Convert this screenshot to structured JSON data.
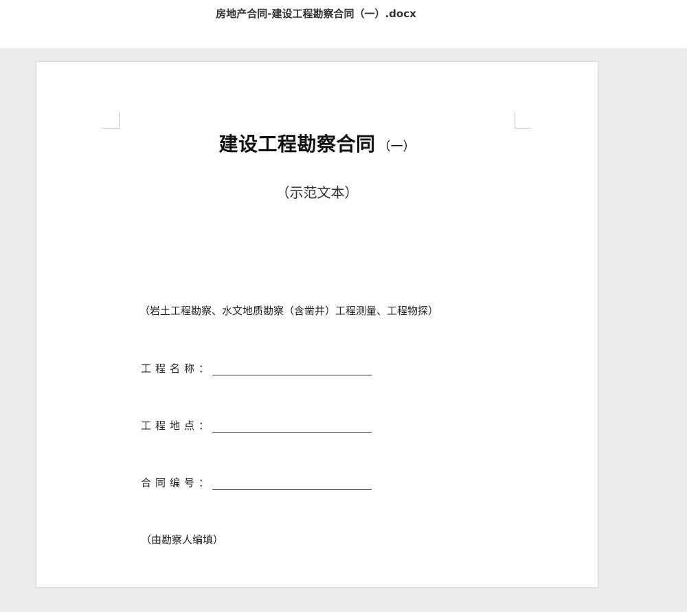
{
  "window": {
    "title": "房地产合同-建设工程勘察合同（一）.docx"
  },
  "document": {
    "title_main": "建设工程勘察合同",
    "title_suffix": "（一）",
    "subtitle": "（示范文本）",
    "scope": "（岩土工程勘察、水文地质勘察（含凿井）工程测量、工程物探）",
    "fields": [
      {
        "label": "工程名称：",
        "value": ""
      },
      {
        "label": "工程地点：",
        "value": ""
      },
      {
        "label": "合同编号：",
        "value": ""
      }
    ],
    "note": "（由勘察人编填）"
  },
  "colors": {
    "canvas_bg": "#ececec",
    "page_bg": "#ffffff",
    "text": "#222222"
  }
}
